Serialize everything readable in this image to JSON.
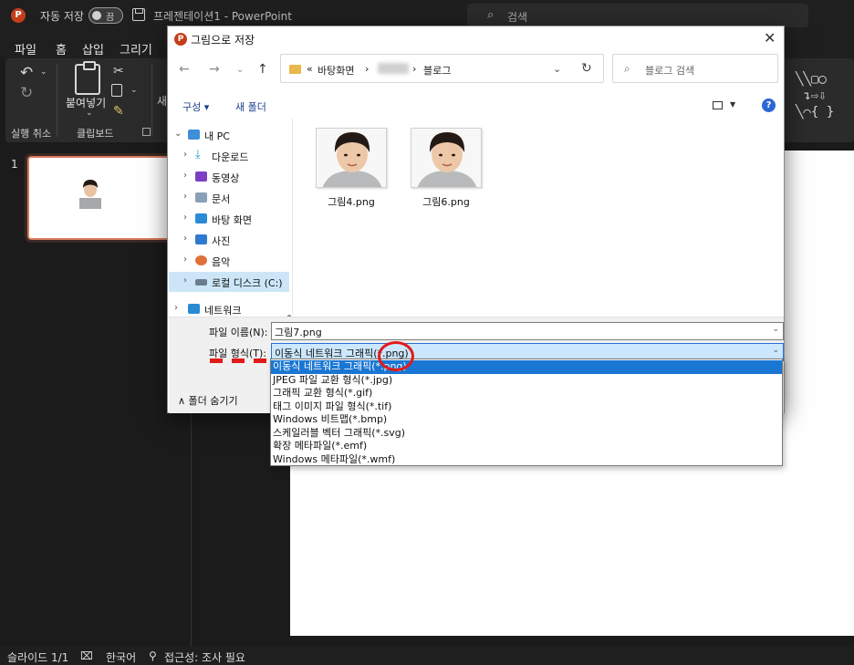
{
  "app": {
    "autosave_label": "자동 저장",
    "autosave_state": "끔",
    "document_title": "프레젠테이션1  -  PowerPoint",
    "search_placeholder": "검색"
  },
  "menu": [
    "파일",
    "홈",
    "삽입",
    "그리기"
  ],
  "ribbon": {
    "paste_label": "붙여넣기",
    "new_label": "새",
    "group_undo": "실행 취소",
    "group_clipboard": "클립보드"
  },
  "slides_panel": {
    "slide_number": "1"
  },
  "status": {
    "slide_info": "슬라이드 1/1",
    "language": "한국어",
    "accessibility": "접근성: 조사 필요"
  },
  "dialog": {
    "title": "그림으로 저장",
    "address": {
      "prefix": "«",
      "seg1": "바탕화면",
      "sep": "›",
      "seg3": "블로그"
    },
    "search_placeholder": "블로그 검색",
    "commands": {
      "organize": "구성 ▾",
      "new_folder": "새 폴더"
    },
    "tree": [
      {
        "label": "내 PC",
        "icon": "pc-icon",
        "color": "#3c8fd8"
      },
      {
        "label": "다운로드",
        "icon": "download-icon",
        "color": "#1f9bd1"
      },
      {
        "label": "동영상",
        "icon": "video-icon",
        "color": "#7b3fc4"
      },
      {
        "label": "문서",
        "icon": "document-icon",
        "color": "#8aa0b8"
      },
      {
        "label": "바탕 화면",
        "icon": "desktop-icon",
        "color": "#2a8ad4"
      },
      {
        "label": "사진",
        "icon": "photo-icon",
        "color": "#2f7ad0"
      },
      {
        "label": "음악",
        "icon": "music-icon",
        "color": "#e0703a"
      },
      {
        "label": "로컬 디스크 (C:)",
        "icon": "disk-icon",
        "color": "#6b7c8f"
      },
      {
        "label": "네트워크",
        "icon": "network-icon",
        "color": "#2a8ad4"
      }
    ],
    "files": [
      {
        "name": "그림4.png"
      },
      {
        "name": "그림6.png"
      }
    ],
    "filename_label": "파일 이름(N):",
    "filename_value": "그림7.png",
    "filetype_label": "파일 형식(T):",
    "filetype_value": "이동식 네트워크 그래픽(*.png)",
    "hide_folders": "∧ 폴더 숨기기",
    "filetype_options": [
      "이동식 네트워크 그래픽(*.png)",
      "JPEG 파일 교환 형식(*.jpg)",
      "그래픽 교환 형식(*.gif)",
      "태그 이미지 파일 형식(*.tif)",
      "Windows 비트맵(*.bmp)",
      "스케일러블 벡터 그래픽(*.svg)",
      "확장 메타파일(*.emf)",
      "Windows 메타파일(*.wmf)"
    ]
  },
  "accent_colors": {
    "ppt_red": "#c43e1c",
    "selection_blue": "#1976d2",
    "annotation_red": "#e21a1a"
  }
}
